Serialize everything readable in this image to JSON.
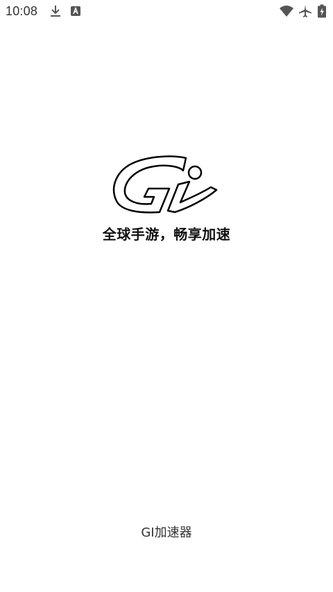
{
  "status_bar": {
    "time": "10:08",
    "left_icons": [
      "download-icon",
      "app-notification-icon"
    ],
    "right_icons": [
      "wifi-icon",
      "airplane-mode-icon",
      "battery-charging-icon"
    ]
  },
  "splash": {
    "slogan": "全球手游，畅享加速",
    "app_name": "GI加速器"
  },
  "colors": {
    "background": "#ffffff",
    "text": "#111111",
    "status_icons": "#555555"
  }
}
